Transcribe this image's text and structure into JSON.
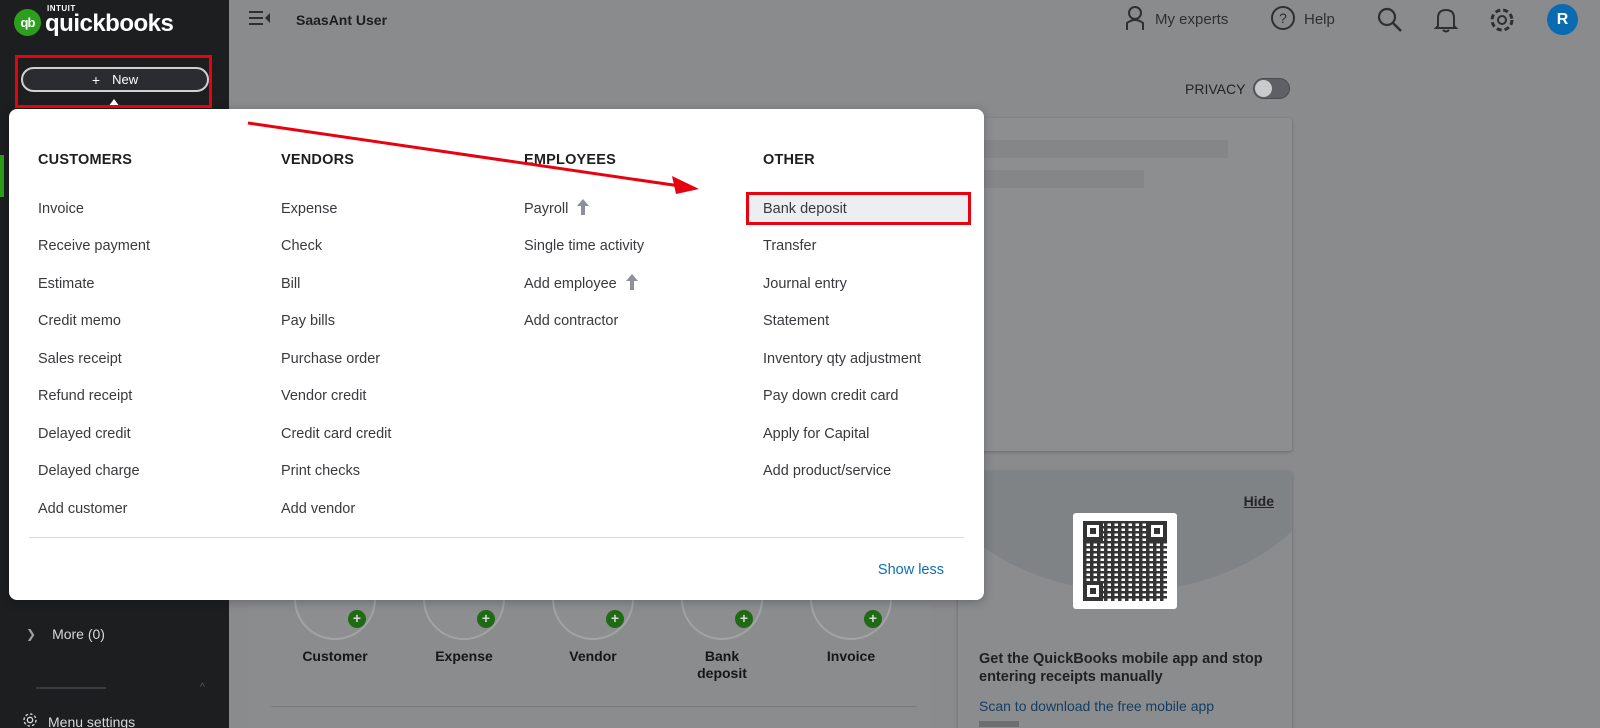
{
  "brand": {
    "intuit": "INTUIT",
    "name": "quickbooks",
    "badge": "qb"
  },
  "sidebar": {
    "new_button": {
      "plus": "+",
      "label": "New"
    },
    "more_item": "More (0)",
    "menu_settings": "Menu settings"
  },
  "topbar": {
    "company": "SaasAnt User",
    "my_experts": "My experts",
    "help": "Help",
    "avatar_initial": "R"
  },
  "dashboard": {
    "privacy_label": "PRIVACY",
    "privacy_on": false,
    "mobile_card": {
      "hide": "Hide",
      "title": "Get the QuickBooks mobile app and stop entering receipts manually",
      "link": "Scan to download the free mobile app"
    },
    "quick_actions": [
      {
        "label": "Customer",
        "icon": "customer-icon"
      },
      {
        "label": "Expense",
        "icon": "expense-icon"
      },
      {
        "label": "Vendor",
        "icon": "vendor-icon"
      },
      {
        "label": "Bank deposit",
        "icon": "bank-deposit-icon"
      },
      {
        "label": "Invoice",
        "icon": "invoice-icon"
      }
    ]
  },
  "new_menu": {
    "columns": [
      {
        "heading": "CUSTOMERS",
        "items": [
          "Invoice",
          "Receive payment",
          "Estimate",
          "Credit memo",
          "Sales receipt",
          "Refund receipt",
          "Delayed credit",
          "Delayed charge",
          "Add customer"
        ]
      },
      {
        "heading": "VENDORS",
        "items": [
          "Expense",
          "Check",
          "Bill",
          "Pay bills",
          "Purchase order",
          "Vendor credit",
          "Credit card credit",
          "Print checks",
          "Add vendor"
        ]
      },
      {
        "heading": "EMPLOYEES",
        "items": [
          "Payroll",
          "Single time activity",
          "Add employee",
          "Add contractor"
        ],
        "upgrade_items": [
          "Payroll",
          "Add employee"
        ]
      },
      {
        "heading": "OTHER",
        "items": [
          "Bank deposit",
          "Transfer",
          "Journal entry",
          "Statement",
          "Inventory qty adjustment",
          "Pay down credit card",
          "Apply for Capital",
          "Add product/service"
        ],
        "highlighted_item": "Bank deposit"
      }
    ],
    "show_less": "Show less"
  },
  "colors": {
    "brand_green": "#2ca01c",
    "annotation_red": "#e8010f",
    "link_blue": "#0d6eb8",
    "avatar_blue": "#0a6bb0"
  }
}
